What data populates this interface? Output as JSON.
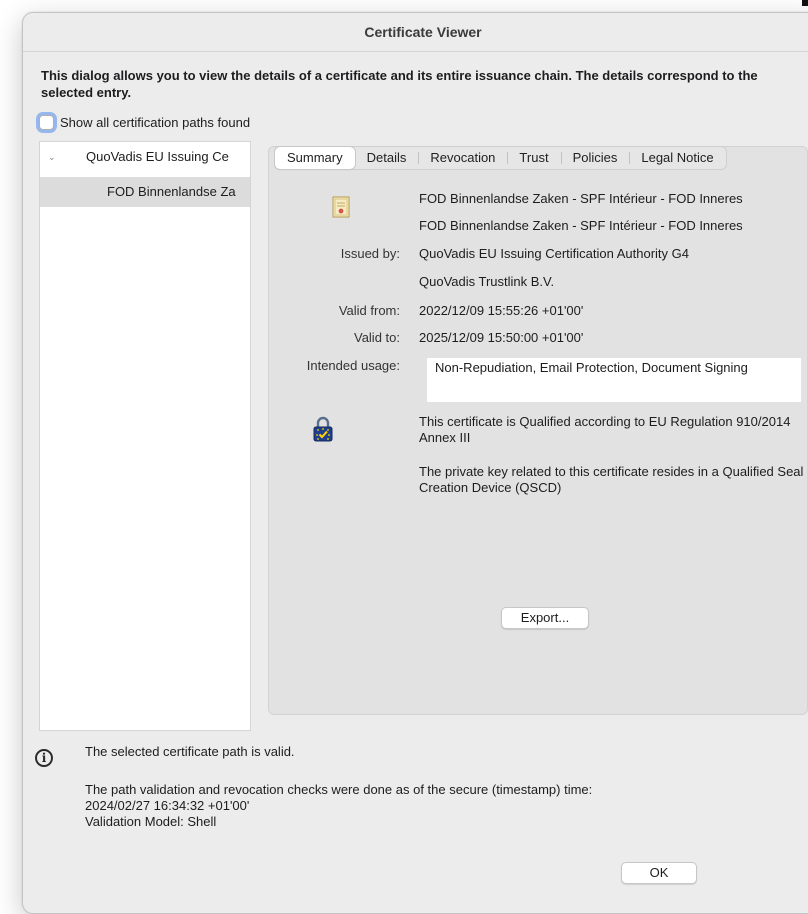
{
  "window": {
    "title": "Certificate Viewer"
  },
  "intro_text": "This dialog allows you to view the details of a certificate and its entire issuance chain. The details correspond to the selected entry.",
  "show_all_paths": {
    "label": "Show all certification paths found",
    "checked": false
  },
  "tree": {
    "items": [
      {
        "label": "QuoVadis EU Issuing Ce",
        "expanded": true,
        "selected": false
      },
      {
        "label": "FOD Binnenlandse Za",
        "selected": true
      }
    ]
  },
  "tabs": [
    {
      "label": "Summary",
      "active": true
    },
    {
      "label": "Details",
      "active": false
    },
    {
      "label": "Revocation",
      "active": false
    },
    {
      "label": "Trust",
      "active": false
    },
    {
      "label": "Policies",
      "active": false
    },
    {
      "label": "Legal Notice",
      "active": false
    }
  ],
  "summary": {
    "subject_line1": "FOD Binnenlandse Zaken - SPF Intérieur - FOD Inneres",
    "subject_line2": "FOD Binnenlandse Zaken - SPF Intérieur - FOD Inneres",
    "issued_by_label": "Issued by:",
    "issuer_line1": "QuoVadis EU Issuing Certification Authority G4",
    "issuer_line2": "QuoVadis Trustlink B.V.",
    "valid_from_label": "Valid from:",
    "valid_from": "2022/12/09 15:55:26 +01'00'",
    "valid_to_label": "Valid to:",
    "valid_to": "2025/12/09 15:50:00 +01'00'",
    "intended_usage_label": "Intended usage:",
    "intended_usage": "Non-Repudiation, Email Protection, Document Signing",
    "qualified_text": "This certificate is Qualified according to EU Regulation 910/2014 Annex III",
    "qscd_text": "The private key related to this certificate resides in a Qualified Seal Creation Device (QSCD)",
    "export_button": "Export..."
  },
  "status": {
    "valid_text": "The selected certificate path is valid.",
    "checks_text": "The path validation and revocation checks were done as of the secure (timestamp) time:",
    "timestamp": "2024/02/27 16:34:32 +01'00'",
    "model": "Validation Model: Shell"
  },
  "ok_button": "OK",
  "icons": {
    "certificate": "certificate-icon",
    "qualified_lock": "eu-qualified-lock-icon",
    "info": "info-icon",
    "tree_chevron": "chevron-down-icon"
  },
  "colors": {
    "focus_ring": "#508cf0",
    "selection": "#dcdcdc",
    "panel": "#e2e2e2"
  }
}
